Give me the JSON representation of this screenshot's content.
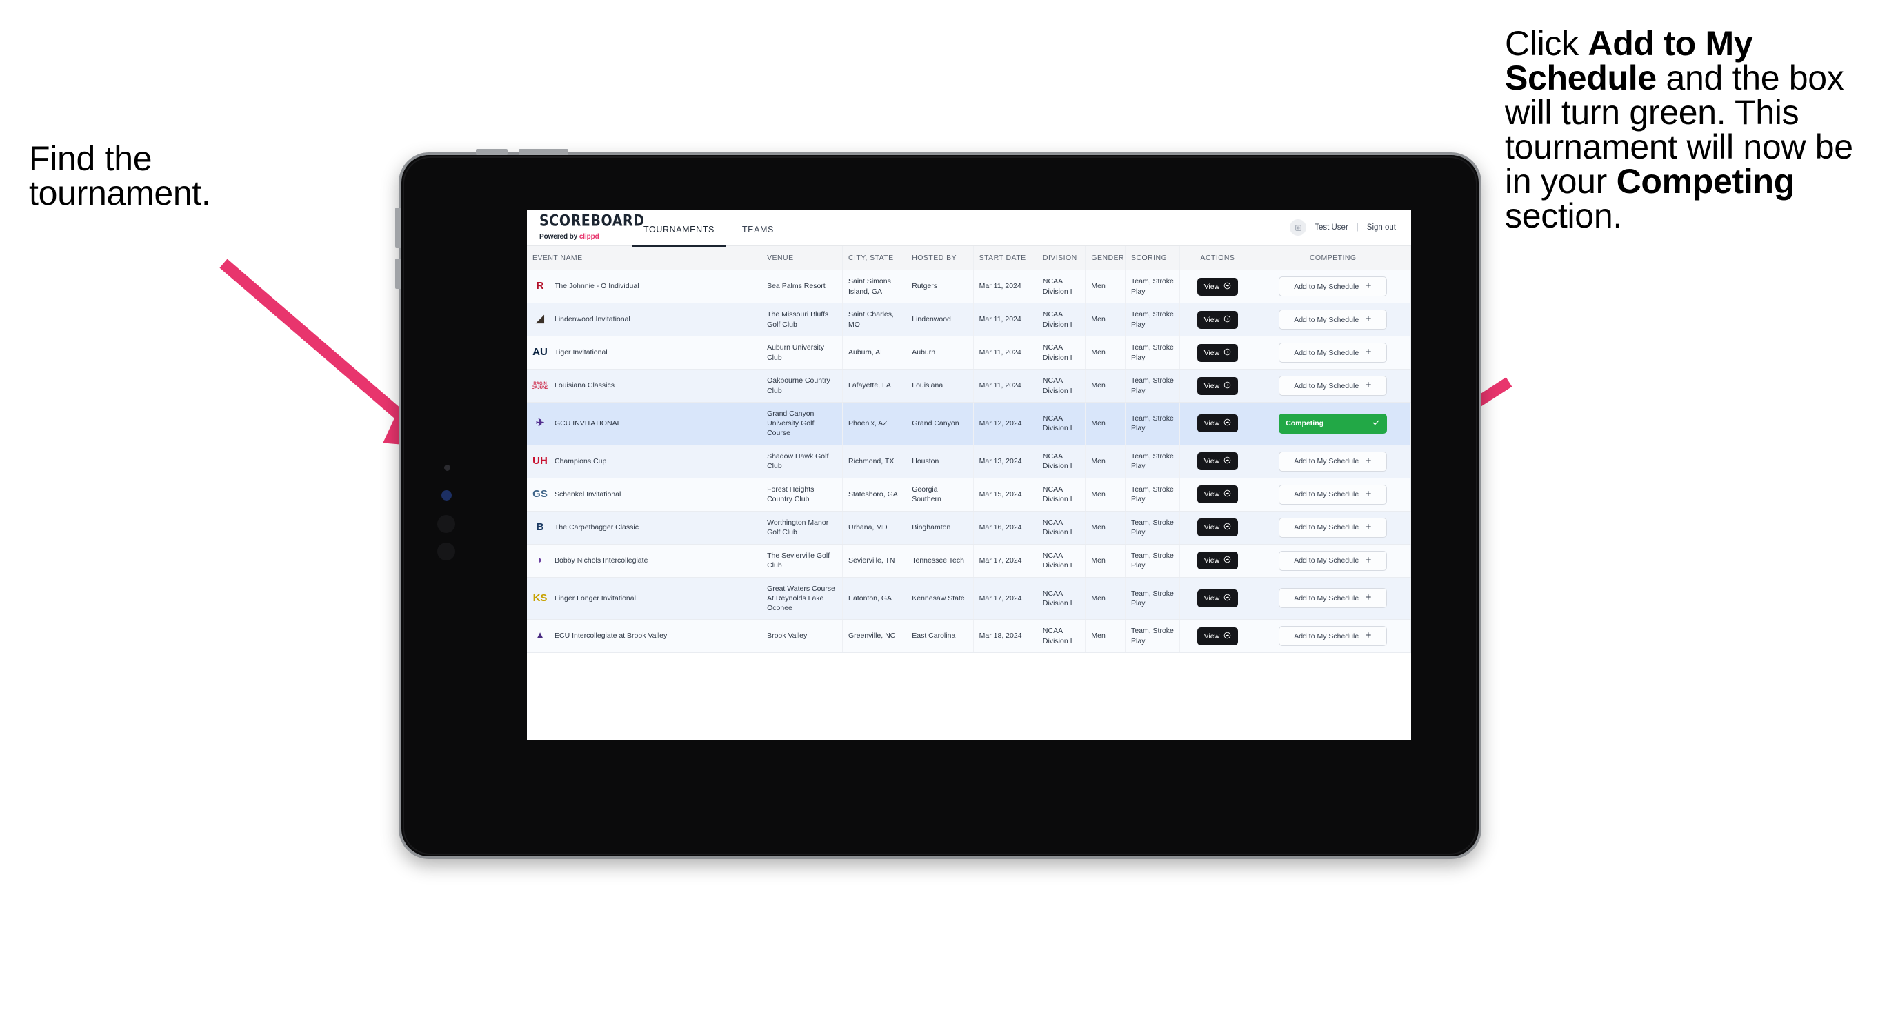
{
  "annotations": {
    "left": {
      "lines": [
        "Find the",
        "tournament."
      ]
    },
    "right": {
      "segments": [
        {
          "t": "Click ",
          "bold": false
        },
        {
          "t": "Add to My Schedule",
          "bold": true
        },
        {
          "t": " and the box will turn green. This tournament will now be in your ",
          "bold": false
        },
        {
          "t": "Competing",
          "bold": true
        },
        {
          "t": " section.",
          "bold": false
        }
      ]
    },
    "arrow_color": "#e8356d"
  },
  "app": {
    "brand": {
      "name": "SCOREBOARD",
      "powered_prefix": "Powered by ",
      "powered_by": "clippd"
    },
    "nav": {
      "tabs": [
        {
          "label": "TOURNAMENTS",
          "active": true
        },
        {
          "label": "TEAMS",
          "active": false
        }
      ]
    },
    "header_right": {
      "avatar_icon": "user-avatar-icon",
      "user": "Test User",
      "separator": "|",
      "sign_out": "Sign out"
    },
    "table": {
      "columns": [
        "EVENT NAME",
        "VENUE",
        "CITY, STATE",
        "HOSTED BY",
        "START DATE",
        "DIVISION",
        "GENDER",
        "SCORING",
        "ACTIONS",
        "COMPETING"
      ],
      "view_label": "View",
      "add_label": "Add to My Schedule",
      "add_icon": "plus-icon",
      "competing_label": "Competing",
      "competing_icon": "check-icon",
      "view_icon": "arrow-circle-right-icon",
      "competing_color": "#22a846",
      "rows": [
        {
          "event": "The Johnnie - O Individual",
          "venue": "Sea Palms Resort",
          "city": "Saint Simons Island, GA",
          "host": "Rutgers",
          "date": "Mar 11, 2024",
          "division": "NCAA Division I",
          "gender": "Men",
          "scoring": "Team, Stroke Play",
          "competing": false,
          "logo": {
            "kind": "letter",
            "text": "R",
            "color": "#b3122b",
            "bg": "transparent"
          }
        },
        {
          "event": "Lindenwood Invitational",
          "venue": "The Missouri Bluffs Golf Club",
          "city": "Saint Charles, MO",
          "host": "Lindenwood",
          "date": "Mar 11, 2024",
          "division": "NCAA Division I",
          "gender": "Men",
          "scoring": "Team, Stroke Play",
          "competing": false,
          "logo": {
            "kind": "shape",
            "text": "◢",
            "color": "#3b3128",
            "bg": "transparent"
          }
        },
        {
          "event": "Tiger Invitational",
          "venue": "Auburn University Club",
          "city": "Auburn, AL",
          "host": "Auburn",
          "date": "Mar 11, 2024",
          "division": "NCAA Division I",
          "gender": "Men",
          "scoring": "Team, Stroke Play",
          "competing": false,
          "logo": {
            "kind": "letter",
            "text": "AU",
            "color": "#0b2341",
            "bg": "transparent"
          }
        },
        {
          "event": "Louisiana Classics",
          "venue": "Oakbourne Country Club",
          "city": "Lafayette, LA",
          "host": "Louisiana",
          "date": "Mar 11, 2024",
          "division": "NCAA Division I",
          "gender": "Men",
          "scoring": "Team, Stroke Play",
          "competing": false,
          "logo": {
            "kind": "block",
            "text": "RAGIN CAJUNS",
            "color": "#ce2a4a",
            "bg": "transparent"
          }
        },
        {
          "event": "GCU INVITATIONAL",
          "venue": "Grand Canyon University Golf Course",
          "city": "Phoenix, AZ",
          "host": "Grand Canyon",
          "date": "Mar 12, 2024",
          "division": "NCAA Division I",
          "gender": "Men",
          "scoring": "Team, Stroke Play",
          "competing": true,
          "selected": true,
          "logo": {
            "kind": "shape",
            "text": "✈",
            "color": "#522d8e",
            "bg": "transparent"
          }
        },
        {
          "event": "Champions Cup",
          "venue": "Shadow Hawk Golf Club",
          "city": "Richmond, TX",
          "host": "Houston",
          "date": "Mar 13, 2024",
          "division": "NCAA Division I",
          "gender": "Men",
          "scoring": "Team, Stroke Play",
          "competing": false,
          "logo": {
            "kind": "letter",
            "text": "UH",
            "color": "#c8102e",
            "bg": "transparent"
          }
        },
        {
          "event": "Schenkel Invitational",
          "venue": "Forest Heights Country Club",
          "city": "Statesboro, GA",
          "host": "Georgia Southern",
          "date": "Mar 15, 2024",
          "division": "NCAA Division I",
          "gender": "Men",
          "scoring": "Team, Stroke Play",
          "competing": false,
          "logo": {
            "kind": "letter",
            "text": "GS",
            "color": "#41668a",
            "bg": "transparent"
          }
        },
        {
          "event": "The Carpetbagger Classic",
          "venue": "Worthington Manor Golf Club",
          "city": "Urbana, MD",
          "host": "Binghamton",
          "date": "Mar 16, 2024",
          "division": "NCAA Division I",
          "gender": "Men",
          "scoring": "Team, Stroke Play",
          "competing": false,
          "logo": {
            "kind": "letter",
            "text": "B",
            "color": "#1b3a63",
            "bg": "transparent"
          }
        },
        {
          "event": "Bobby Nichols Intercollegiate",
          "venue": "The Sevierville Golf Club",
          "city": "Sevierville, TN",
          "host": "Tennessee Tech",
          "date": "Mar 17, 2024",
          "division": "NCAA Division I",
          "gender": "Men",
          "scoring": "Team, Stroke Play",
          "competing": false,
          "logo": {
            "kind": "shape",
            "text": "◗",
            "color": "#6b3fa0",
            "bg": "transparent"
          }
        },
        {
          "event": "Linger Longer Invitational",
          "venue": "Great Waters Course At Reynolds Lake Oconee",
          "city": "Eatonton, GA",
          "host": "Kennesaw State",
          "date": "Mar 17, 2024",
          "division": "NCAA Division I",
          "gender": "Men",
          "scoring": "Team, Stroke Play",
          "competing": false,
          "logo": {
            "kind": "letter",
            "text": "KS",
            "color": "#c8a200",
            "bg": "transparent"
          }
        },
        {
          "event": "ECU Intercollegiate at Brook Valley",
          "venue": "Brook Valley",
          "city": "Greenville, NC",
          "host": "East Carolina",
          "date": "Mar 18, 2024",
          "division": "NCAA Division I",
          "gender": "Men",
          "scoring": "Team, Stroke Play",
          "competing": false,
          "clipped": true,
          "logo": {
            "kind": "shape",
            "text": "▲",
            "color": "#4b2e83",
            "bg": "transparent"
          }
        }
      ]
    }
  }
}
